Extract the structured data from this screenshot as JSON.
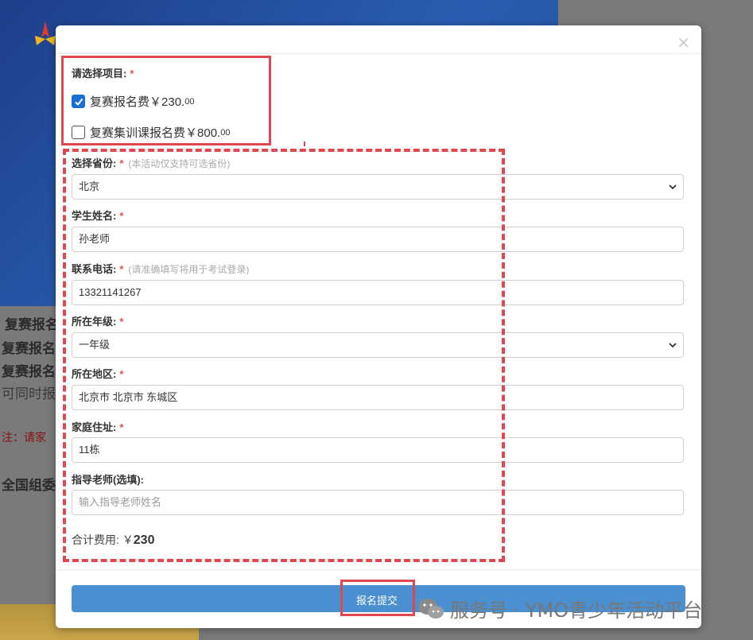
{
  "background": {
    "lines": [
      "复赛报名",
      "复赛报名",
      "复赛报名",
      "可同时报",
      "注：请家",
      "全国组委"
    ]
  },
  "modal": {
    "close_label": "×",
    "project": {
      "label": "请选择项目:",
      "required": "*",
      "options": [
        {
          "name": "复赛报名费",
          "price_main": "￥230.",
          "price_cents": "00",
          "checked": true
        },
        {
          "name": "复赛集训课报名费",
          "price_main": "￥800.",
          "price_cents": "00",
          "checked": false
        }
      ]
    },
    "province": {
      "label": "选择省份:",
      "required": "*",
      "hint": "(本活动仅支持可选省份)",
      "value": "北京"
    },
    "student_name": {
      "label": "学生姓名:",
      "required": "*",
      "value": "孙老师"
    },
    "phone": {
      "label": "联系电话:",
      "required": "*",
      "hint": "(请准确填写将用于考试登录)",
      "value": "13321141267"
    },
    "grade": {
      "label": "所在年级:",
      "required": "*",
      "value": "一年级"
    },
    "region": {
      "label": "所在地区:",
      "required": "*",
      "value": "北京市 北京市 东城区"
    },
    "address": {
      "label": "家庭住址:",
      "required": "*",
      "value": "11栋"
    },
    "teacher": {
      "label": "指导老师(选填):",
      "placeholder": "输入指导老师姓名"
    },
    "total": {
      "label": "合计费用:",
      "currency": "￥",
      "amount": "230"
    },
    "submit_label": "报名提交"
  },
  "watermark": {
    "text": "服务号 · YMO青少年活动平台"
  },
  "colors": {
    "accent": "#4a8fcf",
    "annotation": "#e0474f",
    "required": "#d9534f"
  }
}
